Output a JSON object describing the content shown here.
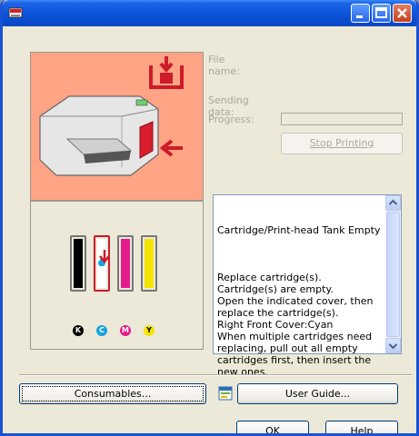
{
  "window": {
    "title": "",
    "colors": {
      "titlebar": "#0b52d8",
      "body": "#ece9d8",
      "printer_panel_bg": "#ffa485",
      "alert": "#cc1b2a"
    }
  },
  "title_buttons": {
    "minimize_icon": "minimize-icon",
    "maximize_icon": "maximize-icon",
    "close_icon": "close-icon"
  },
  "status": {
    "file_name_label": "File name:",
    "sending_data_label": "Sending data:",
    "progress_label": "Progress:"
  },
  "stop_button": "Stop Printing",
  "message": {
    "heading": "Cartridge/Print-head Tank Empty",
    "body": "Replace cartridge(s). Cartridge(s) are empty.\nOpen the indicated cover, then replace the cartridge(s).\nRight Front Cover:Cyan\nWhen multiple cartridges need replacing, pull out all empty cartridges first, then insert the new ones."
  },
  "cartridges": [
    {
      "letter": "K",
      "color": "#000000",
      "empty": false
    },
    {
      "letter": "C",
      "color": "#17a3e0",
      "empty": true
    },
    {
      "letter": "M",
      "color": "#e61a8d",
      "empty": false
    },
    {
      "letter": "Y",
      "color": "#f4e400",
      "empty": false
    }
  ],
  "buttons": {
    "consumables": "Consumables...",
    "user_guide": "User Guide...",
    "ok": "OK",
    "help": "Help"
  }
}
